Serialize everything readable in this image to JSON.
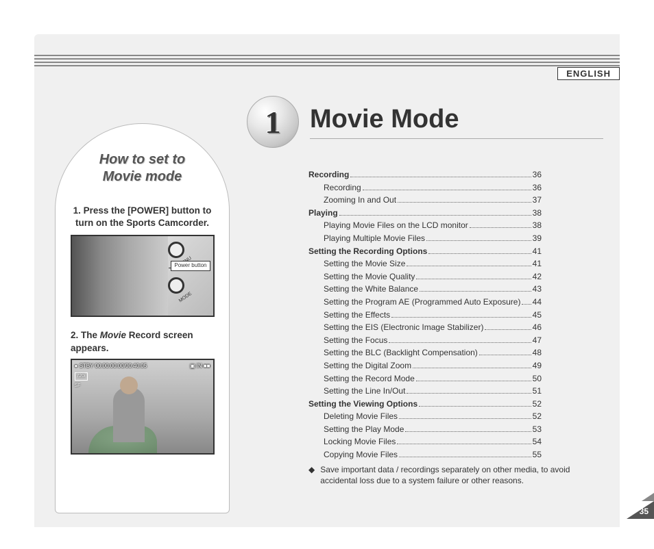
{
  "language_label": "ENGLISH",
  "page_number": "35",
  "section": {
    "number": "1",
    "title": "Movie Mode"
  },
  "sidebar": {
    "title_line1": "How to set to",
    "title_line2": "Movie mode",
    "step1": "1. Press the [POWER] button to turn on the Sports Camcorder.",
    "callout": "Power\nbutton",
    "menu_text": "MENU",
    "mode_text": "MODE",
    "step2_prefix": "2. The ",
    "step2_movie": "Movie",
    "step2_suffix": " Record screen appears.",
    "osd_status": "STBY",
    "osd_time": "00:00:00:00/00:40:05",
    "osd_in": "IN",
    "osd_res": "720i",
    "osd_sf": "SF"
  },
  "toc": [
    {
      "label": "Recording",
      "page": "36",
      "level": 0
    },
    {
      "label": "Recording",
      "page": "36",
      "level": 1
    },
    {
      "label": "Zooming In and Out",
      "page": "37",
      "level": 1
    },
    {
      "label": "Playing",
      "page": "38",
      "level": 0
    },
    {
      "label": "Playing Movie Files on the LCD monitor",
      "page": "38",
      "level": 1
    },
    {
      "label": "Playing Multiple Movie Files",
      "page": "39",
      "level": 1
    },
    {
      "label": "Setting the Recording Options",
      "page": "41",
      "level": 0
    },
    {
      "label": "Setting the Movie Size",
      "page": "41",
      "level": 1
    },
    {
      "label": "Setting the Movie Quality",
      "page": "42",
      "level": 1
    },
    {
      "label": "Setting the White Balance",
      "page": "43",
      "level": 1
    },
    {
      "label": "Setting the Program AE (Programmed Auto Exposure)",
      "page": "44",
      "level": 1
    },
    {
      "label": "Setting the Effects",
      "page": "45",
      "level": 1
    },
    {
      "label": "Setting the EIS (Electronic Image Stabilizer)",
      "page": "46",
      "level": 1
    },
    {
      "label": "Setting the Focus",
      "page": "47",
      "level": 1
    },
    {
      "label": "Setting the BLC (Backlight Compensation)",
      "page": "48",
      "level": 1
    },
    {
      "label": "Setting the Digital Zoom",
      "page": "49",
      "level": 1
    },
    {
      "label": "Setting the Record Mode",
      "page": "50",
      "level": 1
    },
    {
      "label": "Setting the Line In/Out",
      "page": "51",
      "level": 1
    },
    {
      "label": "Setting the Viewing Options",
      "page": "52",
      "level": 0
    },
    {
      "label": "Deleting Movie Files",
      "page": "52",
      "level": 1
    },
    {
      "label": "Setting the Play Mode",
      "page": "53",
      "level": 1
    },
    {
      "label": "Locking Movie Files",
      "page": "54",
      "level": 1
    },
    {
      "label": "Copying Movie Files",
      "page": "55",
      "level": 1
    }
  ],
  "note": "Save important data / recordings separately on other media, to avoid accidental loss due to a system failure or other reasons."
}
